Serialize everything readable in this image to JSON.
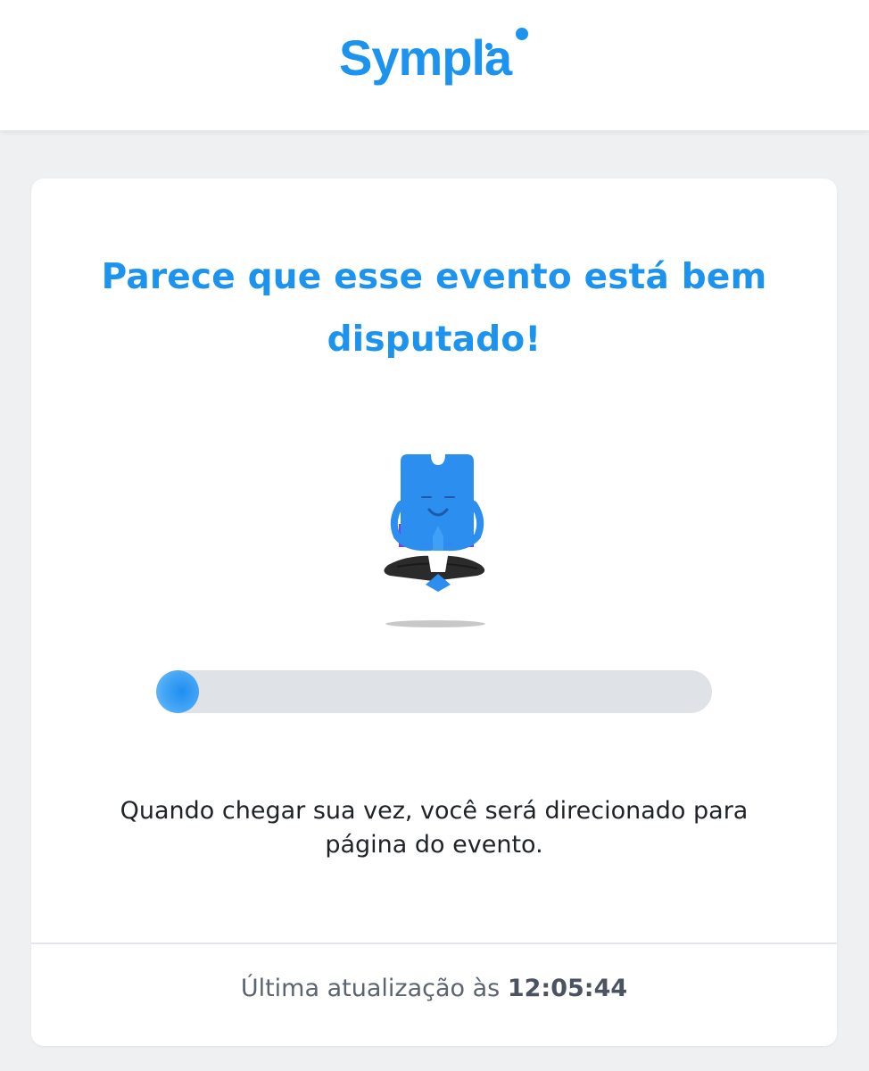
{
  "header": {
    "logo_text": "Sympla",
    "logo_color": "#1c94ef"
  },
  "queue": {
    "headline": "Parece que esse evento está bem disputado!",
    "mascot_icon": "meditating-ticket-mascot-icon",
    "progress": 0.07,
    "message": "Quando chegar sua vez, você será direcionado para página do evento."
  },
  "footer": {
    "updated_label": "Última atualização às",
    "updated_time": "12:05:44"
  },
  "colors": {
    "accent": "#1c94ef",
    "progress_track": "#dfe2e6",
    "background": "#eef0f2"
  }
}
